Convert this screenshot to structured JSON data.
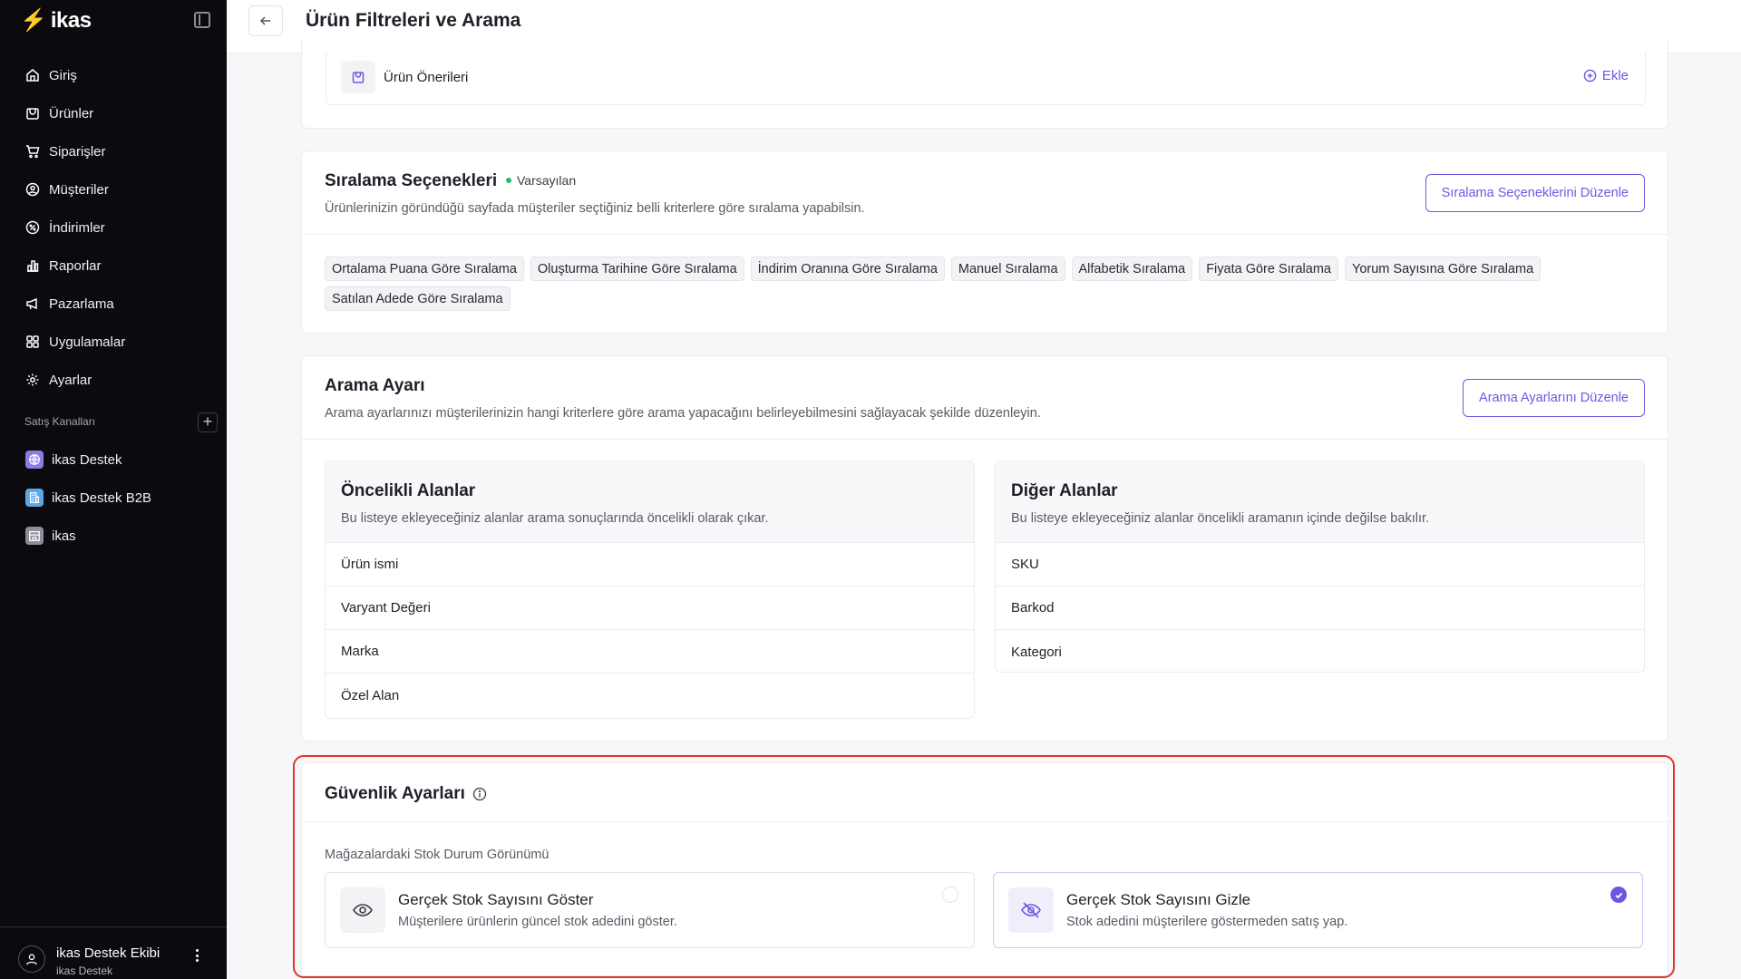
{
  "brand": {
    "name": "ikas",
    "accent": "#6e57e0",
    "highlight": "#e0362b",
    "success": "#2db56f"
  },
  "sidebar": {
    "items": [
      {
        "label": "Giriş",
        "icon": "home-icon"
      },
      {
        "label": "Ürünler",
        "icon": "box-icon"
      },
      {
        "label": "Siparişler",
        "icon": "cart-icon"
      },
      {
        "label": "Müşteriler",
        "icon": "user-circle-icon"
      },
      {
        "label": "İndirimler",
        "icon": "percent-icon"
      },
      {
        "label": "Raporlar",
        "icon": "chart-icon"
      },
      {
        "label": "Pazarlama",
        "icon": "megaphone-icon"
      },
      {
        "label": "Uygulamalar",
        "icon": "grid-icon"
      },
      {
        "label": "Ayarlar",
        "icon": "gear-icon"
      }
    ],
    "section_label": "Satış Kanalları",
    "channels": [
      {
        "label": "ikas Destek",
        "icon": "globe-icon",
        "color": "#8c7ae6"
      },
      {
        "label": "ikas Destek B2B",
        "icon": "building-icon",
        "color": "#5aa8e6"
      },
      {
        "label": "ikas",
        "icon": "store-icon",
        "color": "#8e8e99"
      }
    ],
    "user": {
      "name": "ikas Destek Ekibi",
      "sub": "ikas Destek"
    }
  },
  "header": {
    "title": "Ürün Filtreleri ve Arama"
  },
  "suggestions": {
    "label": "Ürün Önerileri",
    "add_label": "Ekle"
  },
  "sorting": {
    "title": "Sıralama Seçenekleri",
    "badge": "Varsayılan",
    "description": "Ürünlerinizin göründüğü sayfada müşteriler seçtiğiniz belli kriterlere göre sıralama yapabilsin.",
    "edit_label": "Sıralama Seçeneklerini Düzenle",
    "options": [
      "Ortalama Puana Göre Sıralama",
      "Oluşturma Tarihine Göre Sıralama",
      "İndirim Oranına Göre Sıralama",
      "Manuel Sıralama",
      "Alfabetik Sıralama",
      "Fiyata Göre Sıralama",
      "Yorum Sayısına Göre Sıralama",
      "Satılan Adede Göre Sıralama"
    ]
  },
  "search": {
    "title": "Arama Ayarı",
    "description": "Arama ayarlarınızı müşterilerinizin hangi kriterlere göre arama yapacağını belirleyebilmesini sağlayacak şekilde düzenleyin.",
    "edit_label": "Arama Ayarlarını Düzenle",
    "priority": {
      "title": "Öncelikli Alanlar",
      "description": "Bu listeye ekleyeceğiniz alanlar arama sonuçlarında öncelikli olarak çıkar.",
      "fields": [
        "Ürün ismi",
        "Varyant Değeri",
        "Marka",
        "Özel Alan"
      ]
    },
    "other": {
      "title": "Diğer Alanlar",
      "description": "Bu listeye ekleyeceğiniz alanlar öncelikli aramanın içinde değilse bakılır.",
      "fields": [
        "SKU",
        "Barkod",
        "Kategori"
      ]
    }
  },
  "security": {
    "title": "Güvenlik Ayarları",
    "subtitle": "Mağazalardaki Stok Durum Görünümü",
    "options": [
      {
        "title": "Gerçek Stok Sayısını Göster",
        "description": "Müşterilere ürünlerin güncel stok adedini göster.",
        "icon": "eye-icon",
        "selected": false
      },
      {
        "title": "Gerçek Stok Sayısını Gizle",
        "description": "Stok adedini müşterilere göstermeden satış yap.",
        "icon": "eye-off-icon",
        "selected": true
      }
    ]
  }
}
